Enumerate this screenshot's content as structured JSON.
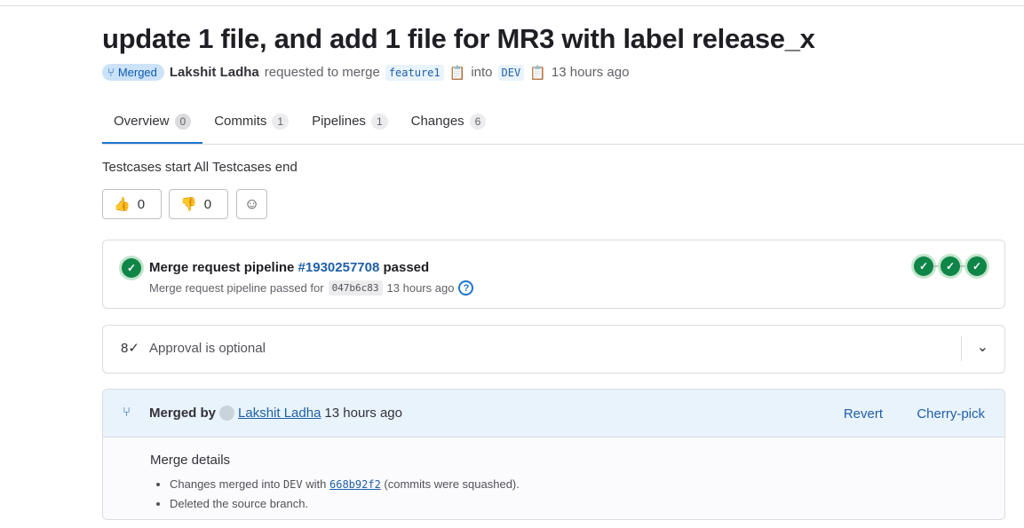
{
  "title": "update 1 file, and add 1 file for MR3 with label release_x",
  "meta": {
    "status": "Merged",
    "author": "Lakshit Ladha",
    "requested": "requested to merge",
    "source": "feature1",
    "into": "into",
    "target": "DEV",
    "time": "13 hours ago"
  },
  "tabs": [
    {
      "label": "Overview",
      "count": "0"
    },
    {
      "label": "Commits",
      "count": "1"
    },
    {
      "label": "Pipelines",
      "count": "1"
    },
    {
      "label": "Changes",
      "count": "6"
    }
  ],
  "description": "Testcases start All Testcases end",
  "reactions": {
    "thumbsup": "0",
    "thumbsdown": "0"
  },
  "pipeline": {
    "prefix": "Merge request pipeline",
    "id": "#1930257708",
    "status": "passed",
    "sub": "Merge request pipeline passed for",
    "sha": "047b6c83",
    "time": "13 hours ago"
  },
  "approval": {
    "text": "Approval is optional"
  },
  "merged": {
    "label": "Merged by",
    "user": "Lakshit Ladha",
    "time": "13 hours ago",
    "revert": "Revert",
    "cherry": "Cherry-pick",
    "details_title": "Merge details",
    "line1_a": "Changes merged into",
    "line1_branch": "DEV",
    "line1_b": "with",
    "line1_sha": "668b92f2",
    "line1_c": "(commits were squashed).",
    "line2": "Deleted the source branch."
  }
}
